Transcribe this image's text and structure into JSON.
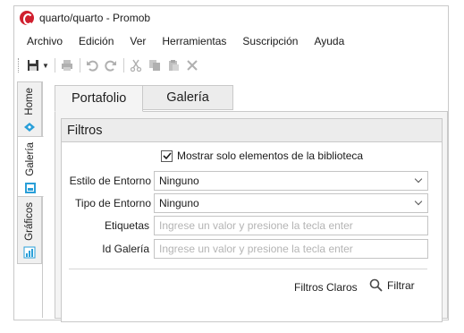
{
  "window": {
    "title": "quarto/quarto - Promob"
  },
  "menu": [
    "Archivo",
    "Edición",
    "Ver",
    "Herramientas",
    "Suscripción",
    "Ayuda"
  ],
  "toolbar": {
    "icons": [
      "save-icon",
      "dropdown-icon",
      "print-icon",
      "undo-icon",
      "redo-icon",
      "cut-icon",
      "copy-icon",
      "paste-icon",
      "delete-icon"
    ]
  },
  "side_tabs": [
    {
      "label": "Home",
      "icon": "home-icon"
    },
    {
      "label": "Galería",
      "icon": "gallery-icon",
      "selected": true
    },
    {
      "label": "Gráficos",
      "icon": "chart-icon"
    }
  ],
  "tabs": [
    {
      "label": "Portafolio",
      "selected": true
    },
    {
      "label": "Galería",
      "selected": false
    }
  ],
  "filters": {
    "header": "Filtros",
    "only_library": {
      "label": "Mostrar solo elementos de la biblioteca",
      "checked": true
    },
    "environment_style": {
      "label": "Estilo de Entorno",
      "value": "Ninguno"
    },
    "environment_type": {
      "label": "Tipo de Entorno",
      "value": "Ninguno"
    },
    "tags": {
      "label": "Etiquetas",
      "placeholder": "Ingrese un valor y presione la tecla enter"
    },
    "gallery_id": {
      "label": "Id Galería",
      "placeholder": "Ingrese un valor y presione la tecla enter"
    },
    "clear_label": "Filtros Claros",
    "filter_label": "Filtrar"
  },
  "colors": {
    "accent": "#d01f2e",
    "gallery_icon": "#2a9fd8",
    "chart_icon": "#2a9fd8"
  }
}
